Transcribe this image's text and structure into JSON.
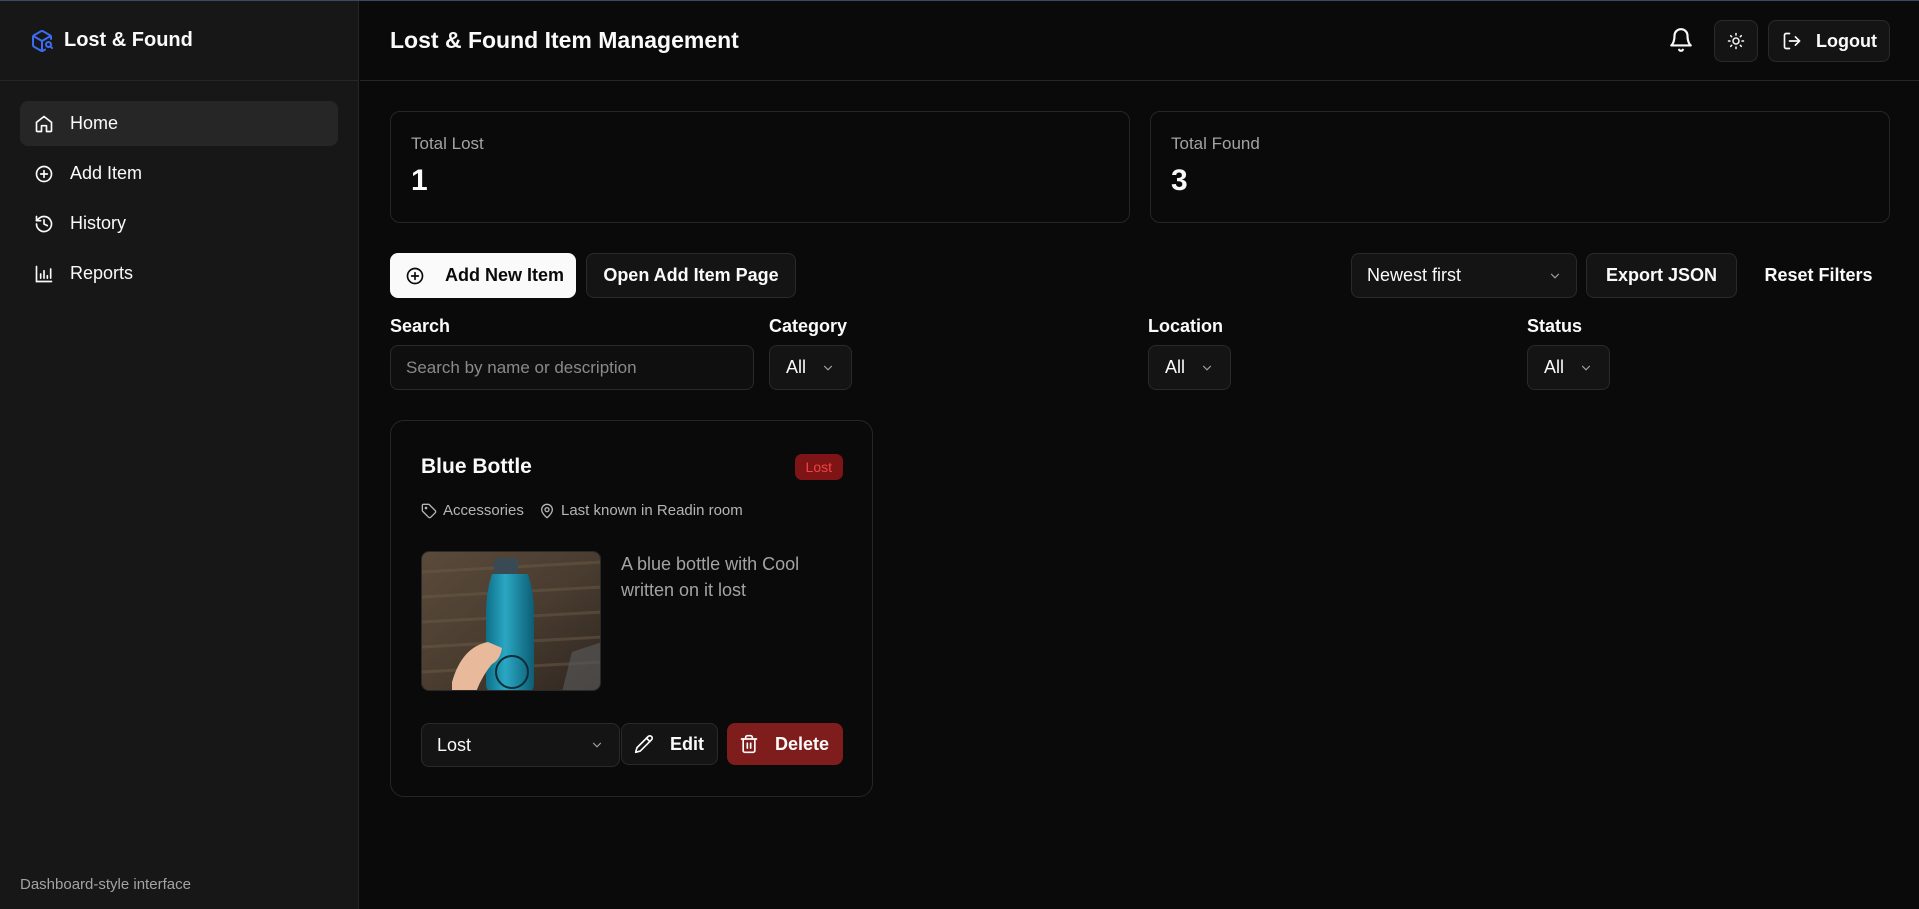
{
  "app": {
    "brand": "Lost & Found",
    "footer": "Dashboard-style interface"
  },
  "sidebar": {
    "items": [
      {
        "label": "Home",
        "icon": "home-icon",
        "active": true
      },
      {
        "label": "Add Item",
        "icon": "plus-circle-icon"
      },
      {
        "label": "History",
        "icon": "history-icon"
      },
      {
        "label": "Reports",
        "icon": "bar-chart-icon"
      }
    ]
  },
  "header": {
    "title": "Lost & Found Item Management",
    "logout_label": "Logout"
  },
  "stats": {
    "lost": {
      "label": "Total Lost",
      "value": "1"
    },
    "found": {
      "label": "Total Found",
      "value": "3"
    }
  },
  "toolbar": {
    "add_new": "Add New Item",
    "open_add_page": "Open Add Item Page",
    "sort_value": "Newest first",
    "export": "Export JSON",
    "reset": "Reset Filters"
  },
  "filters": {
    "search": {
      "label": "Search",
      "placeholder": "Search by name or description",
      "value": ""
    },
    "category": {
      "label": "Category",
      "value": "All"
    },
    "location": {
      "label": "Location",
      "value": "All"
    },
    "status": {
      "label": "Status",
      "value": "All"
    }
  },
  "items": [
    {
      "title": "Blue Bottle",
      "status_badge": "Lost",
      "category": "Accessories",
      "location": "Last known in Readin room",
      "description": "A blue bottle with Cool written on it lost",
      "status_select": "Lost",
      "edit_label": "Edit",
      "delete_label": "Delete"
    }
  ],
  "colors": {
    "accent": "#2563eb",
    "danger": "#7f1d1d",
    "badge_text": "#ef4444"
  }
}
